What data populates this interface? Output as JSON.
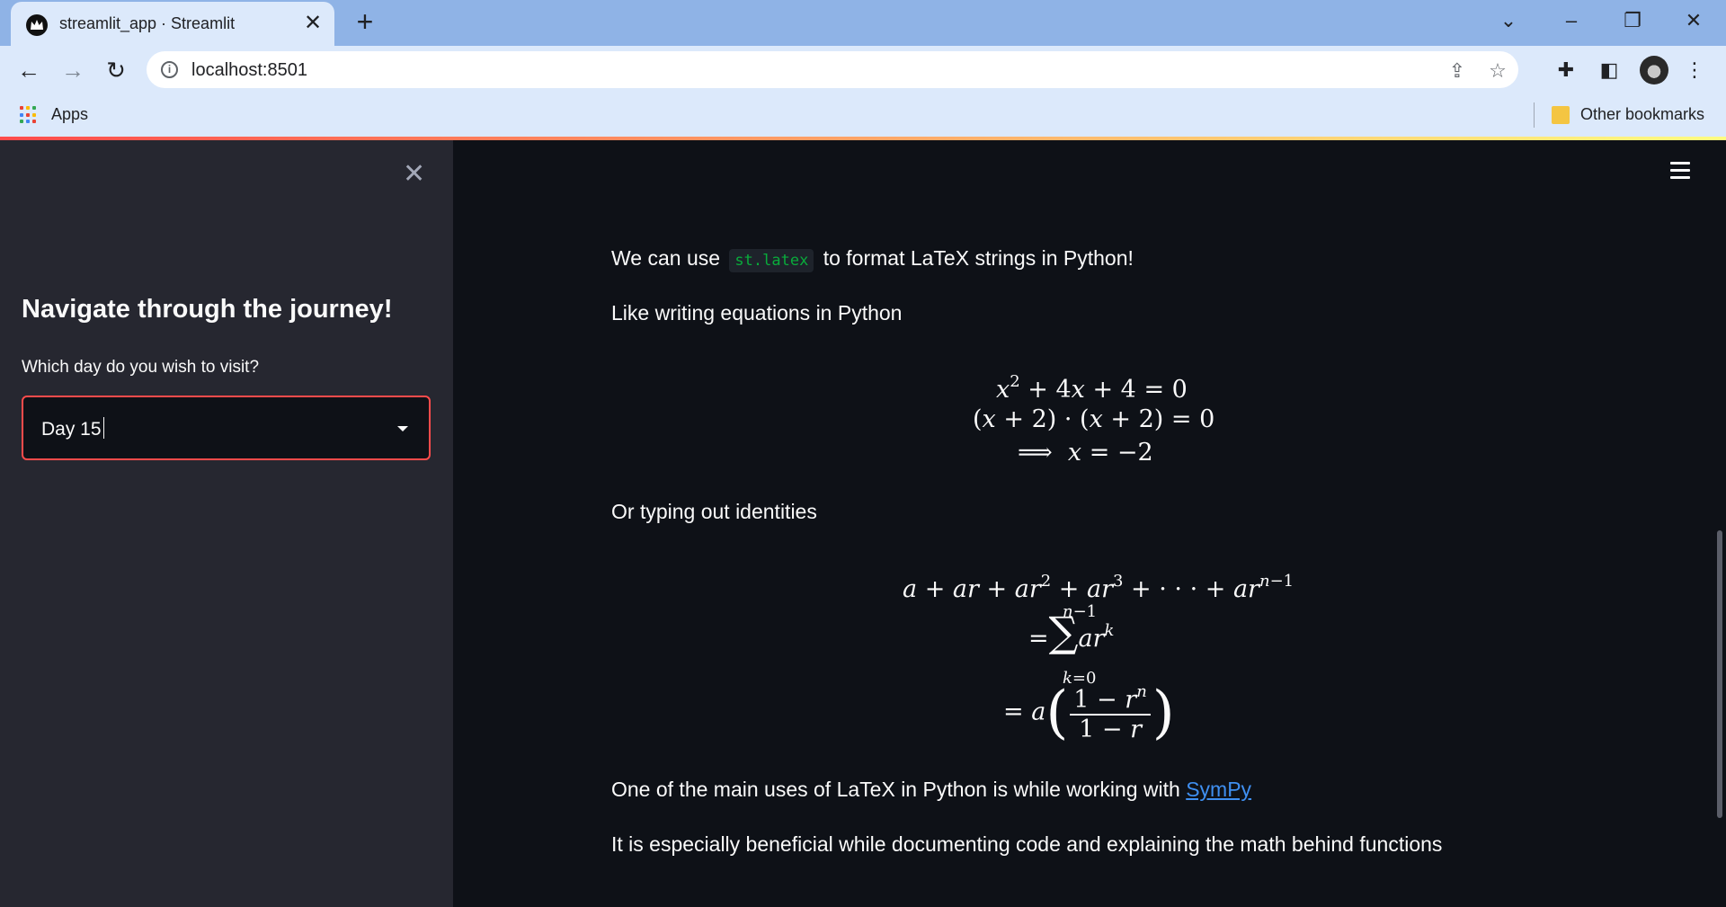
{
  "browser": {
    "tab_title": "streamlit_app · Streamlit",
    "url": "localhost:8501",
    "bookmarks_apps": "Apps",
    "bookmarks_other": "Other bookmarks"
  },
  "sidebar": {
    "heading": "Navigate through the journey!",
    "select_label": "Which day do you wish to visit?",
    "select_value": "Day 15"
  },
  "main": {
    "p1_before": "We can use",
    "p1_code": "st.latex",
    "p1_after": "to format LaTeX strings in Python!",
    "p2": "Like writing equations in Python",
    "p3": "Or typing out identities",
    "p4_before": "One of the main uses of LaTeX in Python is while working with",
    "p4_link": "SymPy",
    "p5": "It is especially beneficial while documenting code and explaining the math behind functions"
  },
  "colors": {
    "sidebar_bg": "#262730",
    "main_bg": "#0e1117",
    "accent": "#ff4b4b",
    "code_green": "#09ab3b",
    "link": "#3f8ff0"
  }
}
